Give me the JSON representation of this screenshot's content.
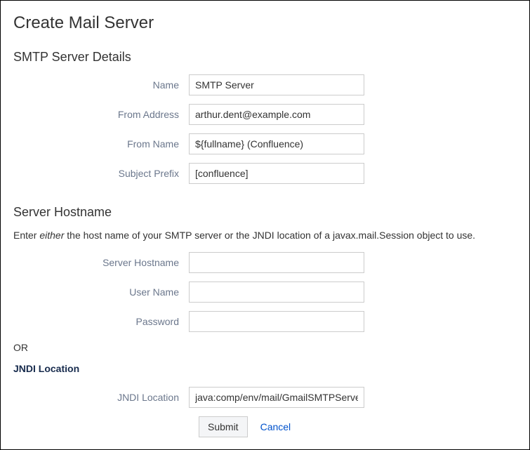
{
  "page": {
    "title": "Create Mail Server"
  },
  "smtp_section": {
    "heading": "SMTP Server Details",
    "fields": {
      "name": {
        "label": "Name",
        "value": "SMTP Server"
      },
      "from_address": {
        "label": "From Address",
        "value": "arthur.dent@example.com"
      },
      "from_name": {
        "label": "From Name",
        "value": "${fullname} (Confluence)"
      },
      "subject_prefix": {
        "label": "Subject Prefix",
        "value": "[confluence]"
      }
    }
  },
  "hostname_section": {
    "heading": "Server Hostname",
    "instruction_pre": "Enter ",
    "instruction_em": "either",
    "instruction_post": " the host name of your SMTP server or the JNDI location of a javax.mail.Session object to use.",
    "fields": {
      "server_hostname": {
        "label": "Server Hostname",
        "value": ""
      },
      "user_name": {
        "label": "User Name",
        "value": ""
      },
      "password": {
        "label": "Password",
        "value": ""
      }
    },
    "or_label": "OR",
    "jndi_heading": "JNDI Location",
    "jndi_field": {
      "label": "JNDI Location",
      "value": "java:comp/env/mail/GmailSMTPServer"
    }
  },
  "buttons": {
    "submit": "Submit",
    "cancel": "Cancel"
  }
}
